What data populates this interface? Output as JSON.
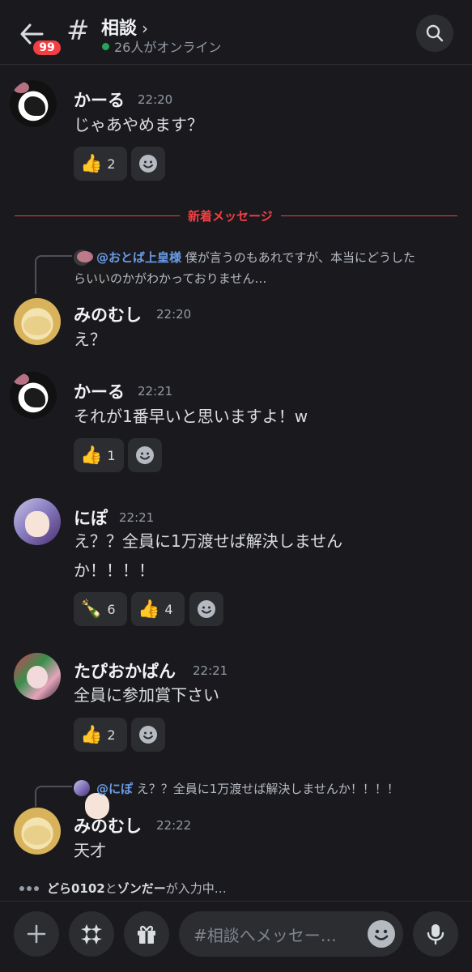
{
  "header": {
    "badge": "99",
    "hash": "#",
    "channel": "相談",
    "chevron": "›",
    "online": "26人がオンライン"
  },
  "divider": {
    "label": "新着メッセージ"
  },
  "messages": [
    {
      "author": "かーる",
      "time": "22:20",
      "text": "じゃあやめます？",
      "reactions": [
        {
          "emoji": "👍",
          "count": "2"
        }
      ]
    },
    {
      "reply_mention": "@おとば上皇様",
      "reply_text1": " 僕が言うのもあれですが、本当にどうした",
      "reply_text2": "らいいのかがわかっておりません…",
      "author": "みのむし",
      "time": "22:20",
      "text": "え？"
    },
    {
      "author": "かーる",
      "time": "22:21",
      "text": "それが1番早いと思いますよ！w",
      "reactions": [
        {
          "emoji": "👍",
          "count": "1"
        }
      ]
    },
    {
      "author": "にぽ",
      "time": "22:21",
      "text1": "え？？全員に1万渡せば解決しません",
      "text2": "か！！！！",
      "reactions": [
        {
          "emoji": "🍾",
          "count": "6"
        },
        {
          "emoji": "👍",
          "count": "4"
        }
      ]
    },
    {
      "author": "たぴおかぱん",
      "time": "22:21",
      "text": "全員に参加賞下さい",
      "reactions": [
        {
          "emoji": "👍",
          "count": "2"
        }
      ]
    },
    {
      "reply_mention": "@にぽ",
      "reply_text1": " え？？全員に1万渡せば解決しませんか！！！！",
      "author": "みのむし",
      "time": "22:22",
      "text": "天才"
    }
  ],
  "typing": {
    "user1": "どら0102",
    "and": " と ",
    "user2": "ゾンだー",
    "suffix": " が入力中…"
  },
  "composer": {
    "placeholder": "#相談へメッセー…"
  }
}
